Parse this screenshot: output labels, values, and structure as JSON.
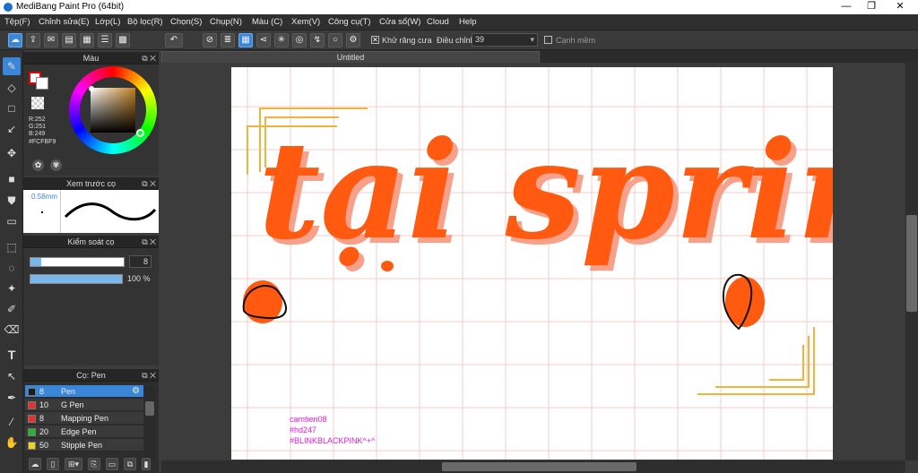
{
  "window": {
    "title": "MediBang Paint Pro (64bit)",
    "minimize": "—",
    "maximize": "❐",
    "close": "✕"
  },
  "menu": [
    "Tệp(F)",
    "Chỉnh sửa(E)",
    "Lớp(L)",
    "Bộ lọc(R)",
    "Chọn(S)",
    "Chụp(N)",
    "Màu (C)",
    "Xem(V)",
    "Công cụ(T)",
    "Cửa sổ(W)",
    "Cloud",
    "Help"
  ],
  "toolbar": {
    "antialias_label": "Khử răng cưa",
    "adjust_label": "Điều chỉnh",
    "adjust_value": "39",
    "sharp_edge_label": "Cạnh mềm"
  },
  "color_panel": {
    "title": "Màu",
    "r": "R:252",
    "g": "G:251",
    "b": "B:249",
    "hex": "#FCFBF9",
    "colors": {
      "primary": "#ff2a00",
      "secondary": "#ffffff",
      "selected": "#fcfbf9"
    }
  },
  "brush_preview": {
    "title": "Xem trước cọ",
    "size": "0.58mm"
  },
  "brush_control": {
    "title": "Kiểm soát cọ",
    "size": "8",
    "opacity": "100 %",
    "size_fraction": 0.12,
    "opacity_fraction": 1.0
  },
  "brush_list": {
    "title": "Cọ: Pen",
    "items": [
      {
        "size": "8",
        "name": "Pen",
        "color": "#1a1a1a",
        "selected": true
      },
      {
        "size": "10",
        "name": "G Pen",
        "color": "#e83030",
        "selected": false
      },
      {
        "size": "8",
        "name": "Mapping Pen",
        "color": "#e83030",
        "selected": false
      },
      {
        "size": "20",
        "name": "Edge Pen",
        "color": "#2ab52a",
        "selected": false
      },
      {
        "size": "50",
        "name": "Stipple Pen",
        "color": "#f0d020",
        "selected": false
      }
    ]
  },
  "document": {
    "tab": "Untitled",
    "artwork_text": "tại spring",
    "signature": [
      "camtien08",
      "#hd247",
      "#BLINKBLACKPINK^+^"
    ],
    "colors": {
      "lettering": "#ff5a0f",
      "shadow": "#f7a08a",
      "frame": "#f2b23c",
      "grid": "#f6c8c8",
      "signature": "#e01cd6"
    }
  }
}
